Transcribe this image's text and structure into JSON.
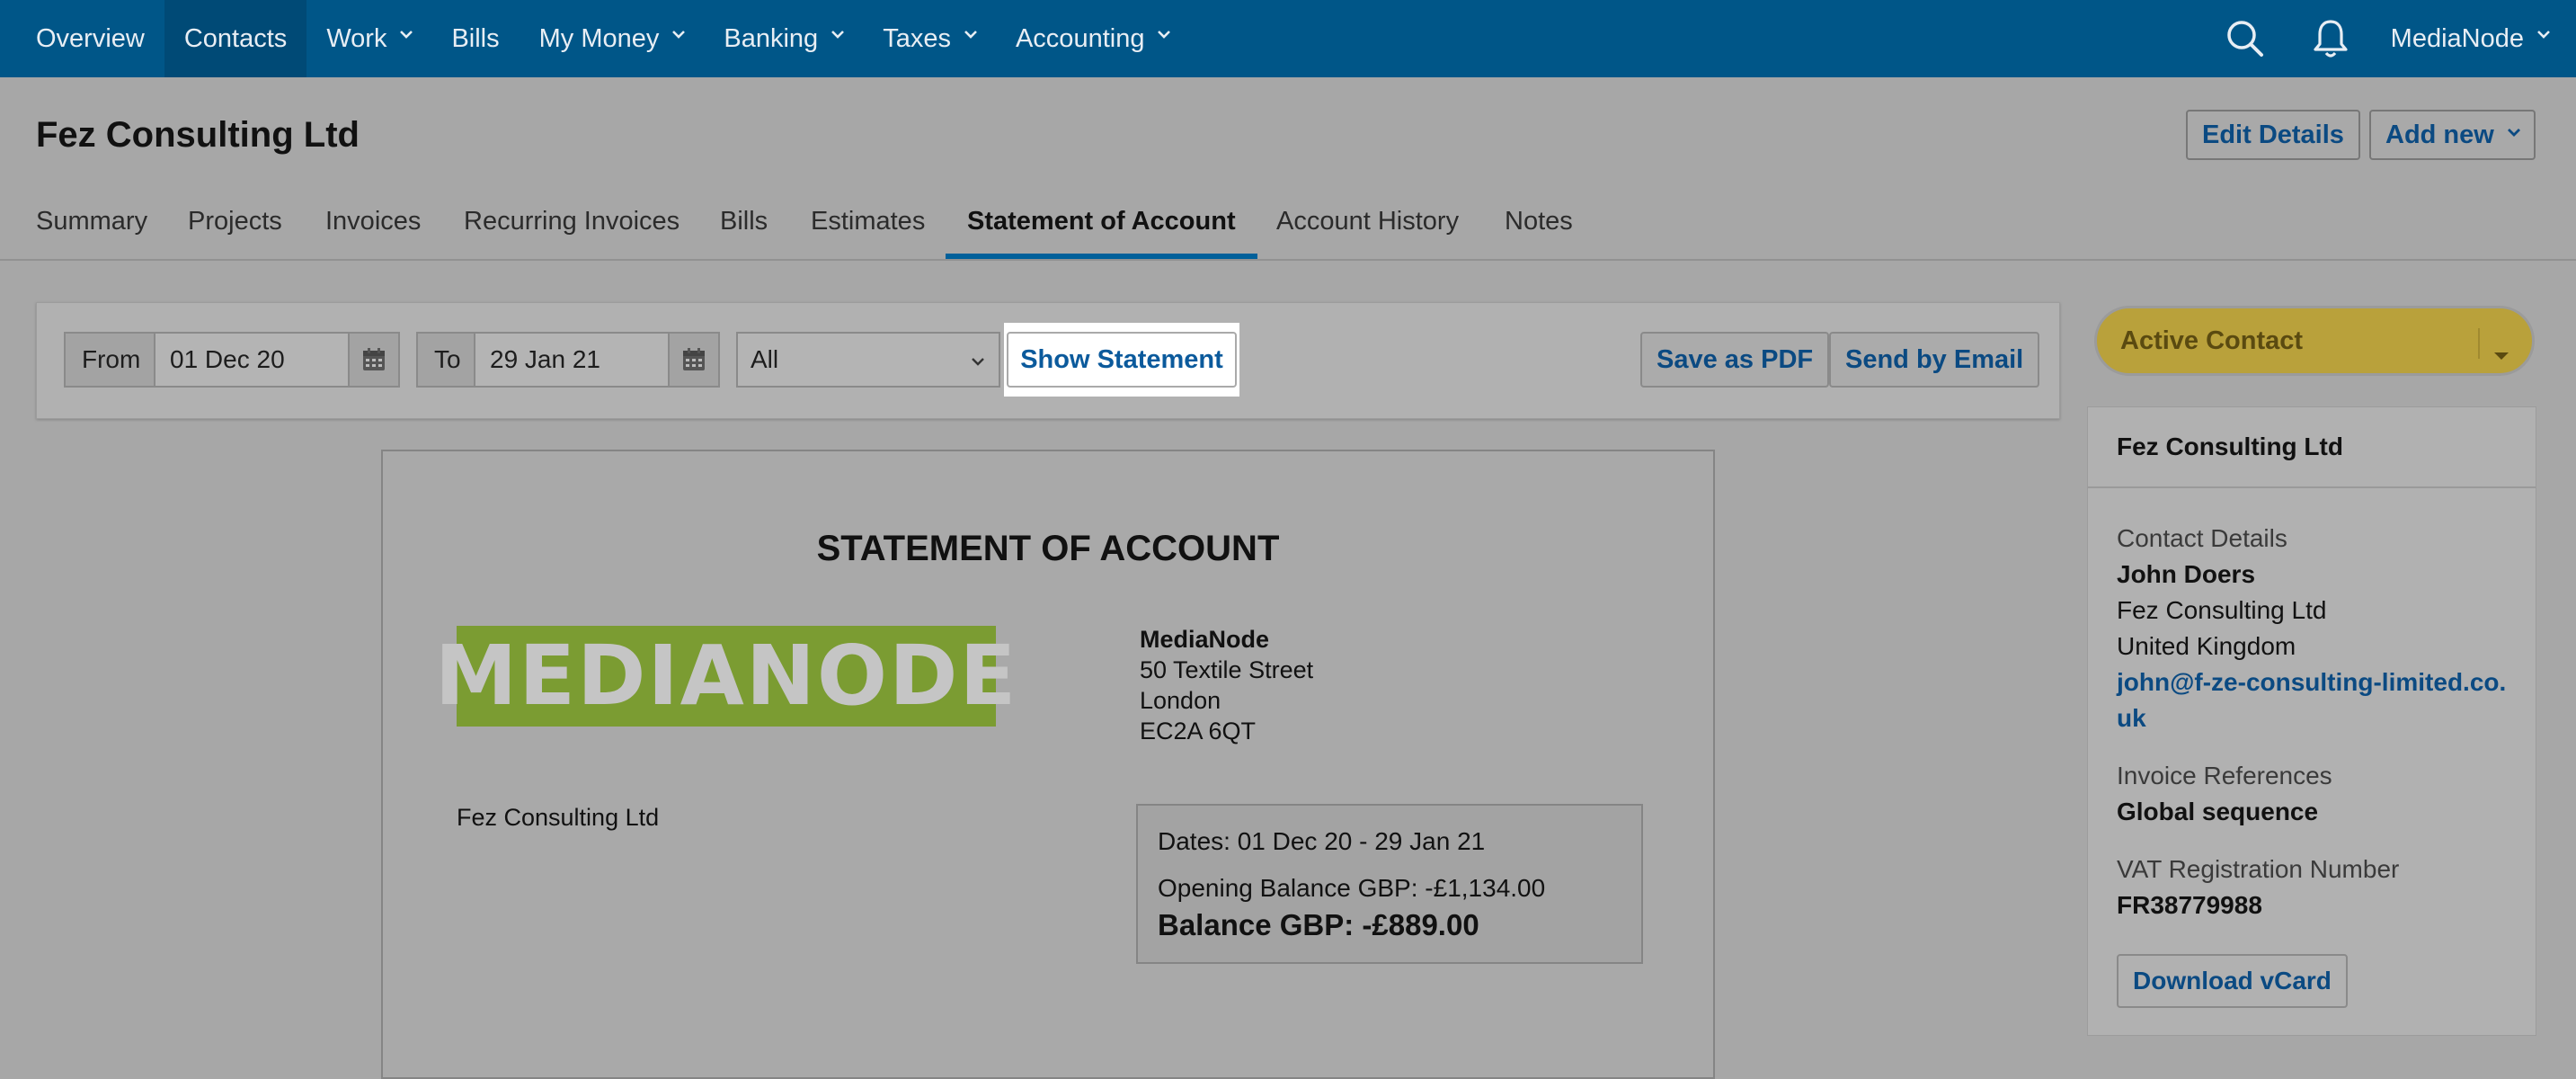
{
  "nav": {
    "items": [
      {
        "label": "Overview",
        "dropdown": false,
        "active": false
      },
      {
        "label": "Contacts",
        "dropdown": false,
        "active": true
      },
      {
        "label": "Work",
        "dropdown": true,
        "active": false
      },
      {
        "label": "Bills",
        "dropdown": false,
        "active": false
      },
      {
        "label": "My Money",
        "dropdown": true,
        "active": false
      },
      {
        "label": "Banking",
        "dropdown": true,
        "active": false
      },
      {
        "label": "Taxes",
        "dropdown": true,
        "active": false
      },
      {
        "label": "Accounting",
        "dropdown": true,
        "active": false
      }
    ],
    "user": "MediaNode",
    "search_icon": "search-icon",
    "bell_icon": "bell-icon"
  },
  "header": {
    "title": "Fez Consulting Ltd",
    "edit_label": "Edit Details",
    "add_label": "Add new"
  },
  "tabs": [
    "Summary",
    "Projects",
    "Invoices",
    "Recurring Invoices",
    "Bills",
    "Estimates",
    "Statement of Account",
    "Account History",
    "Notes"
  ],
  "active_tab": "Statement of Account",
  "filter": {
    "from_label": "From",
    "from_value": "01 Dec 20",
    "to_label": "To",
    "to_value": "29 Jan 21",
    "type_value": "All",
    "show_label": "Show Statement",
    "pdf_label": "Save as PDF",
    "email_label": "Send by Email"
  },
  "statement": {
    "title": "STATEMENT OF ACCOUNT",
    "logo_text": "MEDIANODE",
    "company": "MediaNode",
    "address": [
      "50 Textile Street",
      "London",
      "EC2A 6QT"
    ],
    "customer": "Fez Consulting Ltd",
    "dates": "Dates: 01 Dec 20 - 29 Jan 21",
    "opening": "Opening Balance GBP: -£1,134.00",
    "balance": "Balance GBP: -£889.00"
  },
  "sidebar": {
    "status": "Active Contact",
    "card_title": "Fez Consulting Ltd",
    "contact_label": "Contact Details",
    "contact_name": "John Doers",
    "contact_company": "Fez Consulting Ltd",
    "contact_country": "United Kingdom",
    "contact_email": "john@f-ze-consulting-limited.co.uk",
    "invoice_ref_label": "Invoice References",
    "invoice_ref_value": "Global sequence",
    "vat_label": "VAT Registration Number",
    "vat_value": "FR38779988",
    "vcard_label": "Download vCard"
  },
  "colors": {
    "nav_bg": "#005688",
    "accent": "#0b4a82",
    "logo_green": "#7b9c32",
    "status_yellow": "#b9a13b"
  }
}
